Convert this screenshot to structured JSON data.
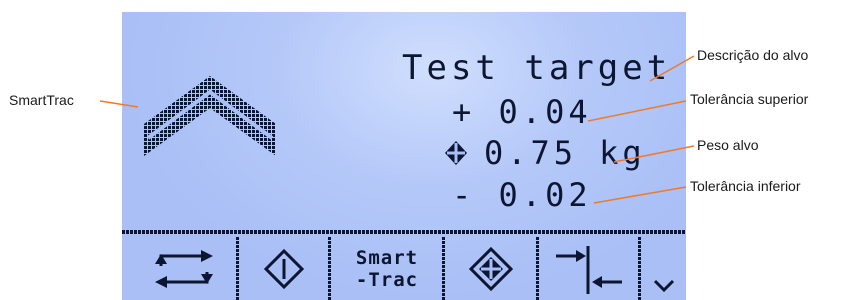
{
  "display": {
    "description": "Test target",
    "upper_tolerance": "+ 0.04",
    "target_weight": "0.75",
    "unit": "kg",
    "lower_tolerance": "- 0.02"
  },
  "softkeys": [
    {
      "id": "swap",
      "icon": "swap-arrows-icon"
    },
    {
      "id": "target",
      "icon": "target-diamond-icon"
    },
    {
      "id": "smarttrac",
      "label_line1": "Smart",
      "label_line2": "-Trac"
    },
    {
      "id": "target-set",
      "icon": "crosshair-diamond-icon"
    },
    {
      "id": "tolerance",
      "icon": "tolerance-arrows-icon"
    },
    {
      "id": "more",
      "icon": "chevron-down-icon"
    }
  ],
  "callouts": {
    "smarttrac": "SmartTrac",
    "description": "Descrição do alvo",
    "upper_tolerance": "Tolerância superior",
    "target_weight": "Peso alvo",
    "lower_tolerance": "Tolerância inferior"
  },
  "colors": {
    "lcd_background": "#a9bff6",
    "lcd_pixel": "#0d1630",
    "leader_line": "#f07a2a"
  }
}
